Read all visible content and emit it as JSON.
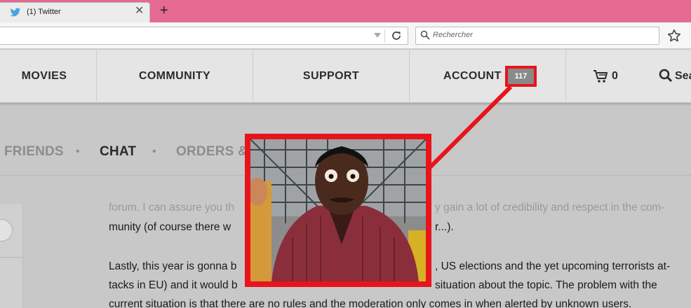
{
  "browser": {
    "tab_title": "(1) Twitter",
    "tab_close": "✕",
    "new_tab": "+",
    "search_placeholder": "Rechercher"
  },
  "nav": {
    "items": [
      {
        "label": "MOVIES"
      },
      {
        "label": "COMMUNITY"
      },
      {
        "label": "SUPPORT"
      },
      {
        "label": "ACCOUNT"
      }
    ],
    "account_badge": "117",
    "cart_count": "0",
    "search_label": "Sea"
  },
  "subnav": {
    "items": [
      {
        "label": "FRIENDS",
        "active": false
      },
      {
        "label": "CHAT",
        "active": true
      },
      {
        "label": "ORDERS & S",
        "active": false
      }
    ],
    "separator": "•"
  },
  "content": {
    "lines": [
      "forum. I can assure you th",
      "y gain a lot of credibility and respect in the com-",
      "munity (of course there w",
      "r...).",
      "Lastly, this year is gonna b",
      ", US elections and the yet upcoming terrorists at-",
      "tacks in EU) and it would b",
      "situation about the topic. The problem with the",
      "current situation is that there are no rules and the moderation only comes in when alerted by unknown users."
    ]
  },
  "colors": {
    "tabstrip": "#e46a92",
    "highlight_red": "#e8141c",
    "nav_bg": "#e5e5e5",
    "badge_bg": "#8a8a8a"
  },
  "icons": {
    "tab": "twitter-bird-icon",
    "reload": "reload-icon",
    "search": "magnifier-icon",
    "bookmark": "star-icon",
    "cart": "cart-icon",
    "nav_search": "search-icon"
  }
}
